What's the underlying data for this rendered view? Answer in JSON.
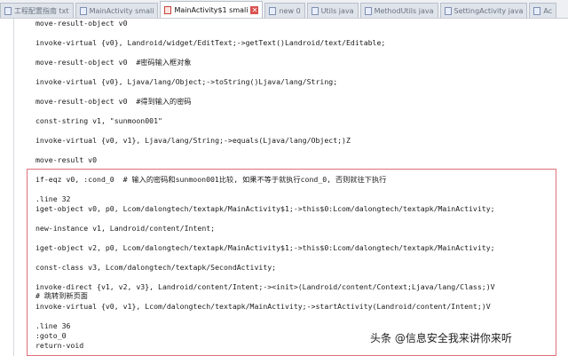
{
  "tabs": [
    {
      "label": "工程配置指南 txt"
    },
    {
      "label": "MainActivity smali"
    },
    {
      "label": "MainActivity$1 smali",
      "active": true
    },
    {
      "label": "new 0"
    },
    {
      "label": "Utils java"
    },
    {
      "label": "MethodUtils java"
    },
    {
      "label": "SettingActivity java"
    },
    {
      "label": "Ac"
    }
  ],
  "code_lines": [
    "move-result-object v0",
    "invoke-virtual {v0}, Landroid/widget/EditText;->getText()Landroid/text/Editable;",
    "move-result-object v0  #密码输入框对象",
    "invoke-virtual {v0}, Ljava/lang/Object;->toString()Ljava/lang/String;",
    "move-result-object v0  #得到输入的密码",
    "const-string v1, \"sunmoon001\"",
    "invoke-virtual {v0, v1}, Ljava/lang/String;->equals(Ljava/lang/Object;)Z",
    "move-result v0",
    "if-eqz v0, :cond_0  # 输入的密码和sunmoon001比较, 如果不等于就执行cond_0, 否则就往下执行",
    ".line 32",
    "iget-object v0, p0, Lcom/dalongtech/textapk/MainActivity$1;->this$0:Lcom/dalongtech/textapk/MainActivity;",
    "new-instance v1, Landroid/content/Intent;",
    "iget-object v2, p0, Lcom/dalongtech/textapk/MainActivity$1;->this$0:Lcom/dalongtech/textapk/MainActivity;",
    "const-class v3, Lcom/dalongtech/textapk/SecondActivity;",
    "invoke-direct {v1, v2, v3}, Landroid/content/Intent;-><init>(Landroid/content/Context;Ljava/lang/Class;)V",
    "# 跳转到新页面",
    "invoke-virtual {v0, v1}, Lcom/dalongtech/textapk/MainActivity;->startActivity(Landroid/content/Intent;)V",
    ".line 36",
    ":goto_0",
    "return-void"
  ],
  "watermark": "头条 @信息安全我来讲你来听"
}
